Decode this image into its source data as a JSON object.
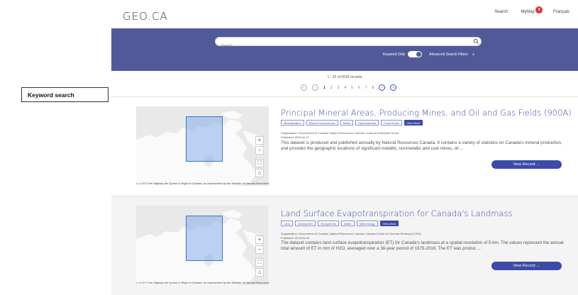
{
  "header": {
    "logo": "GEO.CA",
    "nav": {
      "search": "Search",
      "mymap": "MyMap",
      "mymap_count": "3",
      "language": "Français"
    }
  },
  "search": {
    "placeholder": "Search ...",
    "keyword_only_label": "Keyword Only",
    "keyword_only_on": true,
    "advanced_label": "Advanced Search Filters"
  },
  "results": {
    "count_text": "1 - 10 of 6539 records",
    "pages": [
      "1",
      "2",
      "3",
      "4",
      "5",
      "6",
      "7",
      "8"
    ],
    "current_page": "1"
  },
  "annotation": {
    "label": "Keyword search"
  },
  "colors": {
    "brand": "#515a99",
    "accent": "#3d4aa6",
    "badge": "#d9343c"
  },
  "records": [
    {
      "title": "Principal Mineral Areas, Producing Mines, and Oil and Gas Fields (900A)",
      "tags": [
        "Mineralization",
        "Mineral Occurrences",
        "Mines",
        "Hydrocarbons",
        "Fossil Fuels"
      ],
      "view_more": "View More",
      "organisation": "Organisation: Government of Canada; Natural Resources Canada; Lands and Minerals Sector",
      "published": "Published: 2020-02-27",
      "description": "This dataset is produced and published annually by Natural Resources Canada. It contains a variety of statistics on Canada's mineral production, and provides the geographic locations of significant metallic, nonmetallic and coal mines, oil ...",
      "attribution": "v 1.0.5 © Her Majesty the Queen in Right of Canada, as represented by the Minister of Natural Resources",
      "view_record": "View Record →"
    },
    {
      "title": "Land Surface Evapotranspiration for Canada's Landmass",
      "tags": [
        "Land",
        "Atmosphere",
        "Ecosystems",
        "Water",
        "Meteorology"
      ],
      "view_more": "View More",
      "organisation": "Organisation: Government of Canada; Natural Resources Canada; Canada Centre for Remote Sensing (CCRS)",
      "published": "Published: 2013-03-23",
      "description": "The dataset contains land surface evapotranspiration (ET) for Canada's landmass at a spatial resolution of 5-km. The values represent the annual total amount of ET in mm of H2O, averaged over a 38-year period of 1979-2016. The ET was produc ...",
      "attribution": "v 1.0.5 © Her Majesty the Queen in Right of Canada, as represented by the Minister of Natural Resources",
      "view_record": "View Record →"
    }
  ]
}
